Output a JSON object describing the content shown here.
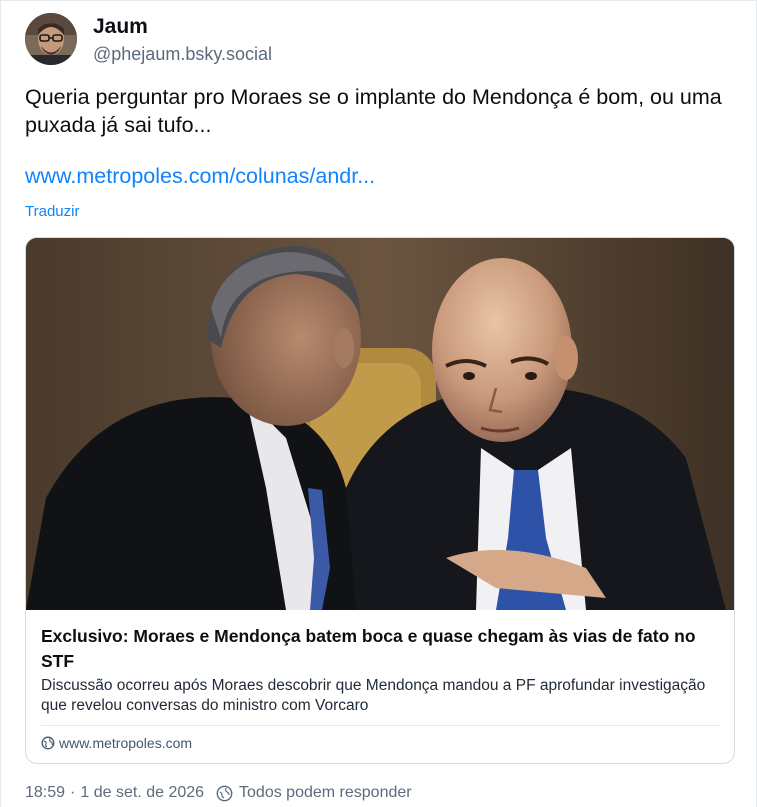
{
  "author": {
    "name": "Jaum",
    "handle": "@phejaum.bsky.social"
  },
  "post": {
    "text": "Queria perguntar pro Moraes se o implante do Mendonça é bom, ou uma puxada já sai tufo...",
    "link": "www.metropoles.com/colunas/andr...",
    "translate_label": "Traduzir"
  },
  "embed": {
    "title": "Exclusivo: Moraes e Mendonça batem boca e quase chegam às vias de fato no STF",
    "description": "Discussão ocorreu após Moraes descobrir que Mendonça mandou a PF aprofundar investigação que revelou conversas do ministro com Vorcaro",
    "domain": "www.metropoles.com",
    "domain_icon": "globe-icon"
  },
  "meta": {
    "time": "18:59",
    "separator": "·",
    "date": "1 de set. de 2026",
    "reply_setting": "Todos podem responder",
    "reply_icon": "reply-permissions-icon"
  },
  "colors": {
    "link": "#1083fe",
    "text": "#0b0f14",
    "muted": "#5b6b7c"
  }
}
